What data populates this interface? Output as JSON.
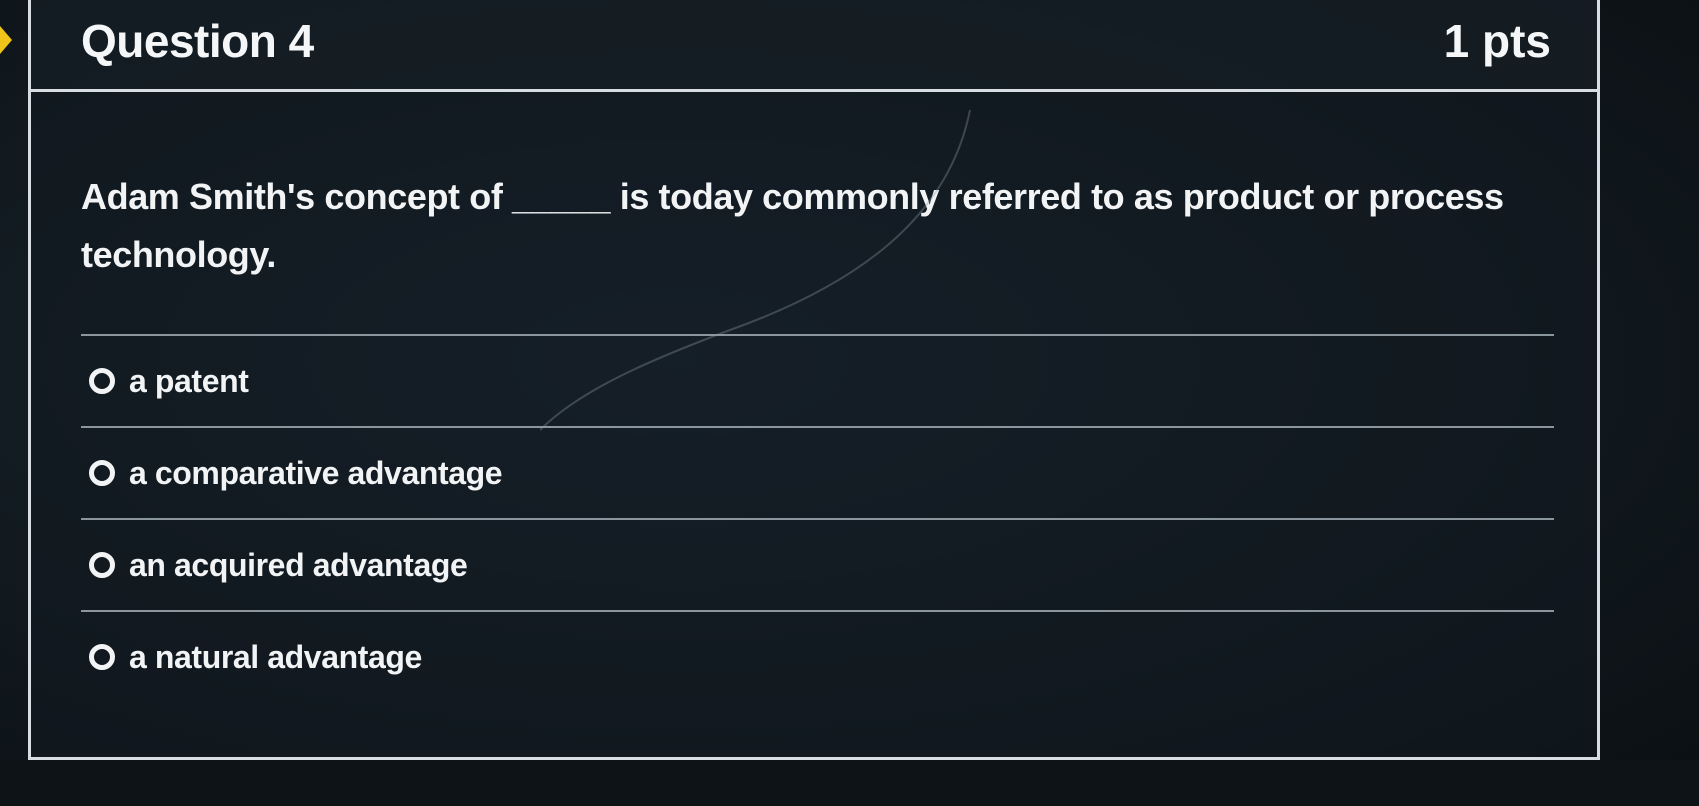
{
  "question": {
    "title": "Question 4",
    "points": "1 pts",
    "text": "Adam Smith's concept of _____ is today commonly referred to as product or process technology."
  },
  "answers": [
    {
      "label": "a patent"
    },
    {
      "label": "a comparative advantage"
    },
    {
      "label": "an acquired advantage"
    },
    {
      "label": "a natural advantage"
    }
  ],
  "colors": {
    "marker": "#f0c419",
    "border": "#d7dde2",
    "text": "#f1f3f4",
    "background": "#121a20"
  }
}
